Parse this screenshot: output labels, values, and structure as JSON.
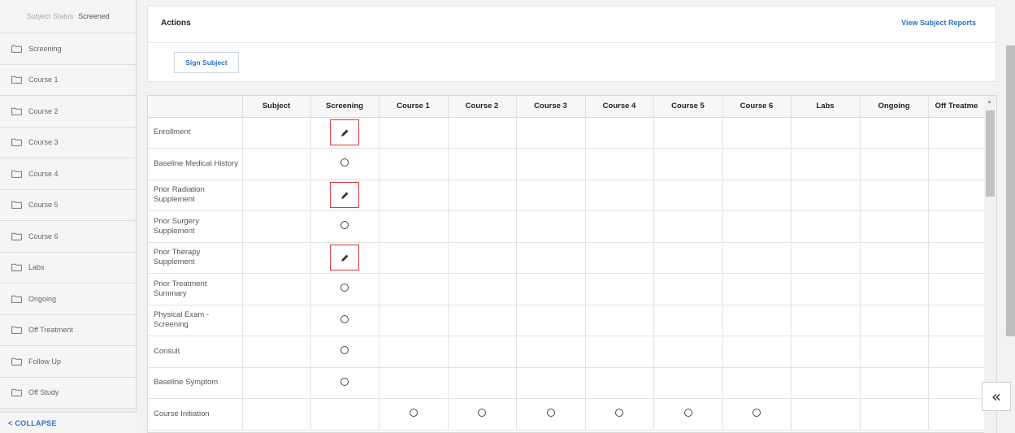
{
  "sidebar": {
    "status_label": "Subject Status",
    "status_value": "Screened",
    "items": [
      {
        "label": "Screening"
      },
      {
        "label": "Course 1"
      },
      {
        "label": "Course 2"
      },
      {
        "label": "Course 3"
      },
      {
        "label": "Course 4"
      },
      {
        "label": "Course 5"
      },
      {
        "label": "Course 6"
      },
      {
        "label": "Labs"
      },
      {
        "label": "Ongoing"
      },
      {
        "label": "Off Treatment"
      },
      {
        "label": "Follow Up"
      },
      {
        "label": "Off Study"
      }
    ],
    "collapse_label": "< COLLAPSE"
  },
  "actions": {
    "title": "Actions",
    "view_reports": "View Subject Reports",
    "sign_subject": "Sign Subject"
  },
  "grid": {
    "columns": [
      "",
      "Subject",
      "Screening",
      "Course 1",
      "Course 2",
      "Course 3",
      "Course 4",
      "Course 5",
      "Course 6",
      "Labs",
      "Ongoing",
      "Off Treatme"
    ],
    "rows": [
      {
        "label": "Enrollment",
        "cells": [
          "",
          "pencil",
          "",
          "",
          "",
          "",
          "",
          "",
          "",
          "",
          ""
        ]
      },
      {
        "label": "Baseline Medical History",
        "cells": [
          "",
          "circle",
          "",
          "",
          "",
          "",
          "",
          "",
          "",
          "",
          ""
        ]
      },
      {
        "label": "Prior Radiation Supplement",
        "cells": [
          "",
          "pencil",
          "",
          "",
          "",
          "",
          "",
          "",
          "",
          "",
          ""
        ]
      },
      {
        "label": "Prior Surgery Supplement",
        "cells": [
          "",
          "circle",
          "",
          "",
          "",
          "",
          "",
          "",
          "",
          "",
          ""
        ]
      },
      {
        "label": "Prior Therapy Supplement",
        "cells": [
          "",
          "pencil",
          "",
          "",
          "",
          "",
          "",
          "",
          "",
          "",
          ""
        ]
      },
      {
        "label": "Prior Treatment Summary",
        "cells": [
          "",
          "circle",
          "",
          "",
          "",
          "",
          "",
          "",
          "",
          "",
          ""
        ]
      },
      {
        "label": "Physical Exam - Screening",
        "cells": [
          "",
          "circle",
          "",
          "",
          "",
          "",
          "",
          "",
          "",
          "",
          ""
        ]
      },
      {
        "label": "Consult",
        "cells": [
          "",
          "circle",
          "",
          "",
          "",
          "",
          "",
          "",
          "",
          "",
          ""
        ]
      },
      {
        "label": "Baseline Symptom",
        "cells": [
          "",
          "circle",
          "",
          "",
          "",
          "",
          "",
          "",
          "",
          "",
          ""
        ]
      },
      {
        "label": "Course Initiation",
        "cells": [
          "",
          "",
          "circle",
          "circle",
          "circle",
          "circle",
          "circle",
          "circle",
          "",
          "",
          ""
        ]
      }
    ]
  },
  "expand_icon": "«"
}
